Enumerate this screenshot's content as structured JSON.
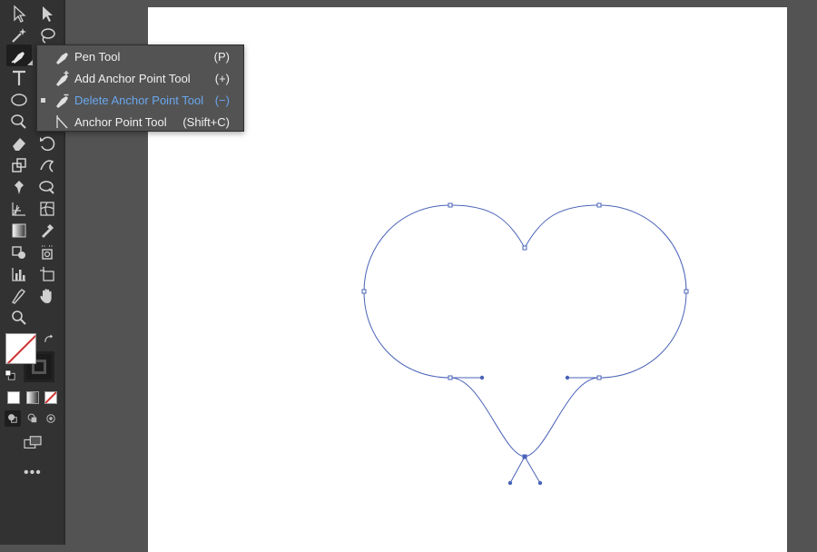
{
  "window": {
    "title": ""
  },
  "toolbar": {
    "tools": [
      {
        "name": "selection-tool-icon"
      },
      {
        "name": "direct-selection-tool-icon"
      },
      {
        "name": "magic-wand-tool-icon"
      },
      {
        "name": "lasso-tool-icon"
      },
      {
        "name": "pen-tool-icon"
      },
      {
        "name": "type-tool-icon"
      },
      {
        "name": "ellipse-tool-icon"
      },
      {
        "name": "paintbrush-tool-icon"
      },
      {
        "name": "eraser-tool-icon"
      },
      {
        "name": "rotate-tool-icon"
      },
      {
        "name": "scale-tool-icon"
      },
      {
        "name": "warp-tool-icon"
      },
      {
        "name": "puppet-warp-tool-icon"
      },
      {
        "name": "free-transform-tool-icon"
      },
      {
        "name": "perspective-grid-tool-icon"
      },
      {
        "name": "mesh-tool-icon"
      },
      {
        "name": "gradient-tool-icon"
      },
      {
        "name": "eyedropper-tool-icon"
      },
      {
        "name": "shape-builder-tool-icon"
      },
      {
        "name": "live-paint-bucket-icon"
      },
      {
        "name": "graph-tool-icon"
      },
      {
        "name": "artboard-tool-icon"
      },
      {
        "name": "slice-tool-icon"
      },
      {
        "name": "hand-tool-icon"
      },
      {
        "name": "zoom-tool-icon"
      }
    ],
    "more_label": "•••"
  },
  "pen_flyout": {
    "items": [
      {
        "label": "Pen Tool",
        "shortcut": "(P)",
        "icon": "pen-tool-icon",
        "current": false
      },
      {
        "label": "Add Anchor Point Tool",
        "shortcut": "(+)",
        "icon": "add-anchor-point-icon",
        "current": false
      },
      {
        "label": "Delete Anchor Point Tool",
        "shortcut": "(−)",
        "icon": "delete-anchor-point-icon",
        "current": true
      },
      {
        "label": "Anchor Point Tool",
        "shortcut": "(Shift+C)",
        "icon": "anchor-point-icon",
        "current": false
      }
    ]
  },
  "colors": {
    "path_stroke": "#4a63b8",
    "current_item": "#6aa7ee",
    "none_slash": "#d0312d"
  }
}
